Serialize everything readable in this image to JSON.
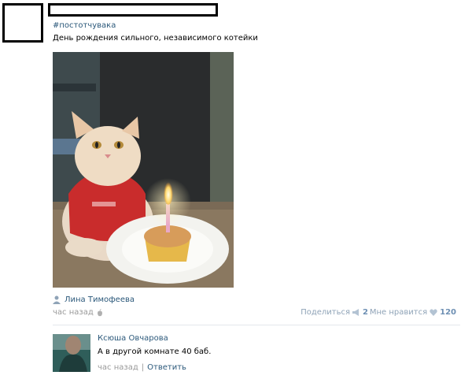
{
  "post": {
    "hashtag": "#постотчувака",
    "text": "День рождения сильного, независимого котейки",
    "photo_subject": "cat in red bib with candle cupcake",
    "author_name": "Лина Тимофеева",
    "time": "час назад",
    "share_label": "Поделиться",
    "share_count": "2",
    "like_label": "Мне нравится",
    "like_count": "120"
  },
  "comment": {
    "author": "Ксюша Овчарова",
    "text": "А в другой комнате 40 баб.",
    "time": "час назад",
    "separator": "|",
    "reply_label": "Ответить"
  },
  "colors": {
    "link": "#2b587a",
    "meta": "#999999",
    "accent": "#6d8fb3"
  }
}
